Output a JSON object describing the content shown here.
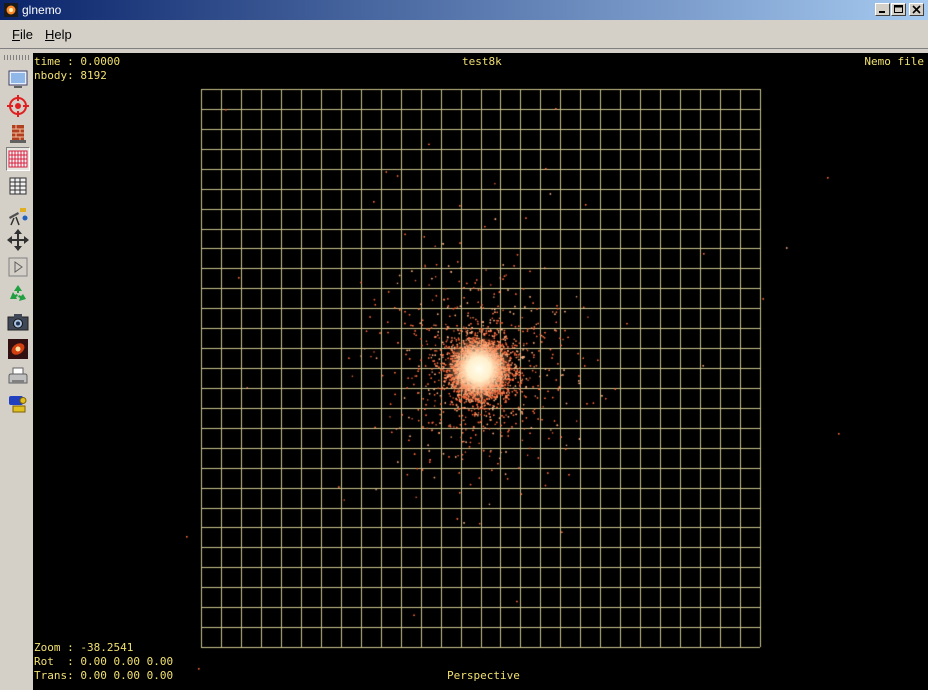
{
  "window": {
    "title": "glnemo"
  },
  "menu": {
    "file": "File",
    "help": "Help"
  },
  "toolbar": {
    "items": [
      {
        "icon": "screen-icon"
      },
      {
        "icon": "target-icon"
      },
      {
        "icon": "firewall-icon"
      },
      {
        "icon": "grid-icon",
        "active": true
      },
      {
        "icon": "list-icon"
      },
      {
        "icon": "telescope-icon"
      },
      {
        "icon": "move-arrows-icon"
      },
      {
        "icon": "play-icon"
      },
      {
        "icon": "recycle-icon"
      },
      {
        "icon": "camera-icon"
      },
      {
        "icon": "nebula-icon"
      },
      {
        "icon": "printer-icon"
      },
      {
        "icon": "projector-icon"
      }
    ]
  },
  "hud": {
    "time_label": "time : 0.0000",
    "nbody_label": "nbody: 8192",
    "file_title": "test8k",
    "file_type": "Nemo file",
    "zoom_label": "Zoom : -38.2541",
    "rot_label": "Rot  : 0.00 0.00 0.00",
    "trans_label": "Trans: 0.00 0.00 0.00",
    "projection": "Perspective"
  },
  "colors": {
    "grid": "#c8c28a",
    "particles": "#ff6a3c",
    "core": "#ffffe8",
    "hud_text": "#f0e070",
    "title_start": "#0a246a",
    "title_end": "#a6caf0"
  }
}
